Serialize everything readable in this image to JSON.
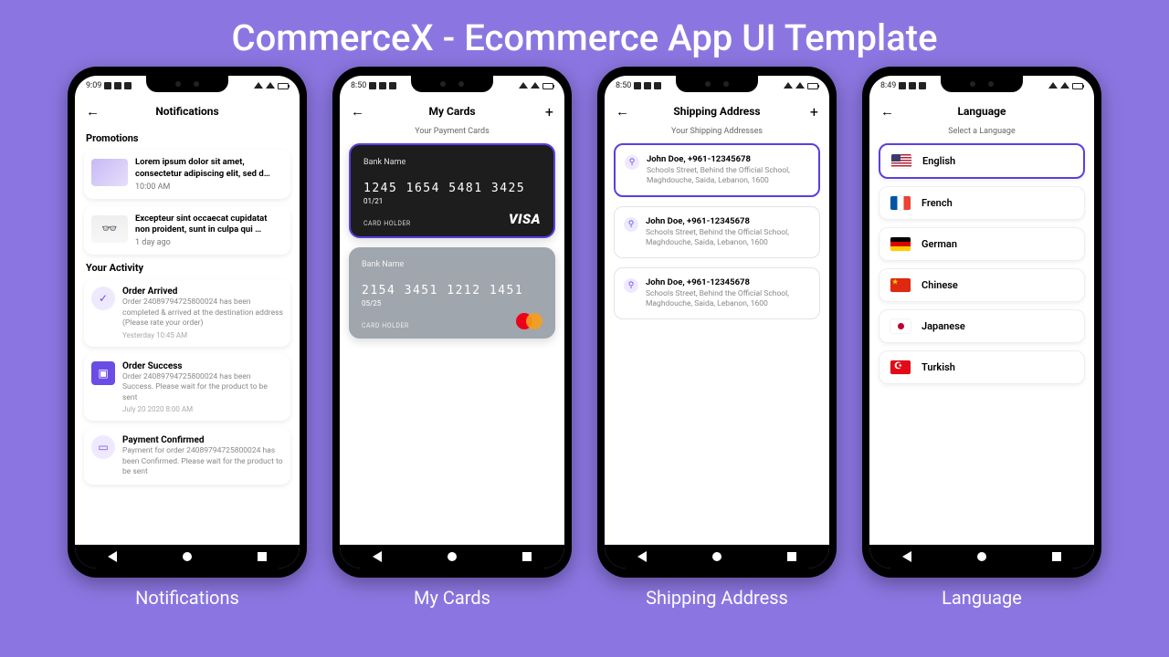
{
  "title": "CommerceX - Ecommerce App UI Template",
  "captions": [
    "Notifications",
    "My Cards",
    "Shipping Address",
    "Language"
  ],
  "accent": "#5a3fe0",
  "phones": {
    "notifications": {
      "time": "9:09",
      "header": "Notifications",
      "section1": "Promotions",
      "promo1_title": "Lorem ipsum dolor sit amet, consectetur adipiscing elit, sed d…",
      "promo1_time": "10:00 AM",
      "promo2_title": "Excepteur sint occaecat cupidatat non proident, sunt in culpa qui …",
      "promo2_time": "1 day ago",
      "section2": "Your Activity",
      "act1_title": "Order Arrived",
      "act1_body": "Order 24089794725800024 has been completed & arrived at the destination address (Please rate your order)",
      "act1_time": "Yesterday 10:45 AM",
      "act2_title": "Order Success",
      "act2_body": "Order 24089794725800024 has been Success. Please wait for the product to be sent",
      "act2_time": "July 20 2020 8:00 AM",
      "act3_title": "Payment Confirmed",
      "act3_body": "Payment for order 24089794725800024 has been Confirmed. Please wait for the product to be sent"
    },
    "cards": {
      "time": "8:50",
      "header": "My Cards",
      "sub": "Your Payment Cards",
      "c1_bank": "Bank Name",
      "c1_num": "1245 1654 5481 3425",
      "c1_exp": "01/21",
      "c1_holder": "CARD HOLDER",
      "c1_brand": "VISA",
      "c2_bank": "Bank Name",
      "c2_num": "2154 3451 1212 1451",
      "c2_exp": "05/25",
      "c2_holder": "CARD HOLDER"
    },
    "shipping": {
      "time": "8:50",
      "header": "Shipping Address",
      "sub": "Your Shipping Addresses",
      "name": "John Doe, +961-12345678",
      "addr": "Schools Street, Behind the Official School, Maghdouche, Saida, Lebanon, 1600"
    },
    "language": {
      "time": "8:49",
      "header": "Language",
      "sub": "Select a Language",
      "langs": {
        "en": "English",
        "fr": "French",
        "de": "German",
        "cn": "Chinese",
        "jp": "Japanese",
        "tr": "Turkish"
      }
    }
  }
}
